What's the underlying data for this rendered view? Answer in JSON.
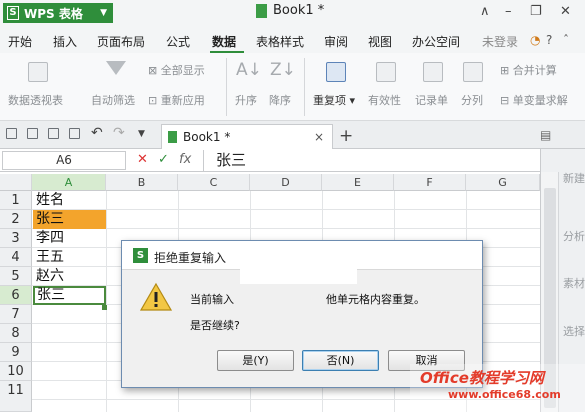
{
  "app": {
    "name": "WPS 表格",
    "doc_title": "Book1 *"
  },
  "window_controls": [
    "∧",
    "–",
    "❐",
    "✕"
  ],
  "menu": [
    "开始",
    "插入",
    "页面布局",
    "公式",
    "数据",
    "表格样式",
    "审阅",
    "视图",
    "办公空间"
  ],
  "menu_active_index": 4,
  "account": {
    "login": "未登录"
  },
  "ribbon": {
    "pivot": "数据透视表",
    "autofilter": "自动筛选",
    "show_all": "全部显示",
    "reapply": "重新应用",
    "sort_asc": "升序",
    "sort_desc": "降序",
    "duplicates": "重复项",
    "validity": "有效性",
    "records": "记录单",
    "split": "分列",
    "merge_calc": "合并计算",
    "single_var": "单变量求解"
  },
  "tab": {
    "label": "Book1 *",
    "close": "×",
    "add": "+"
  },
  "formula": {
    "cell_ref": "A6",
    "value": "张三",
    "fx": "fx",
    "cancel": "✕",
    "confirm": "✓"
  },
  "columns": [
    "A",
    "B",
    "C",
    "D",
    "E",
    "F",
    "G"
  ],
  "rows": [
    "1",
    "2",
    "3",
    "4",
    "5",
    "6",
    "7",
    "8",
    "9",
    "10",
    "11"
  ],
  "cells": [
    "姓名",
    "张三",
    "李四",
    "王五",
    "赵六",
    "张三"
  ],
  "right_pane": [
    "新建",
    "分析",
    "素材",
    "选择"
  ],
  "dialog": {
    "logo": "S",
    "title": "拒绝重复输入",
    "message_start": "当前输入",
    "message_end": "他单元格内容重复。",
    "question": "是否继续?",
    "yes": "是(Y)",
    "no": "否(N)",
    "cancel": "取消"
  },
  "watermark": {
    "line1": "Office教程学习网",
    "line2": "www.office68.com"
  },
  "colors": {
    "accent": "#2f8e3b",
    "highlight": "#f3a42c"
  }
}
